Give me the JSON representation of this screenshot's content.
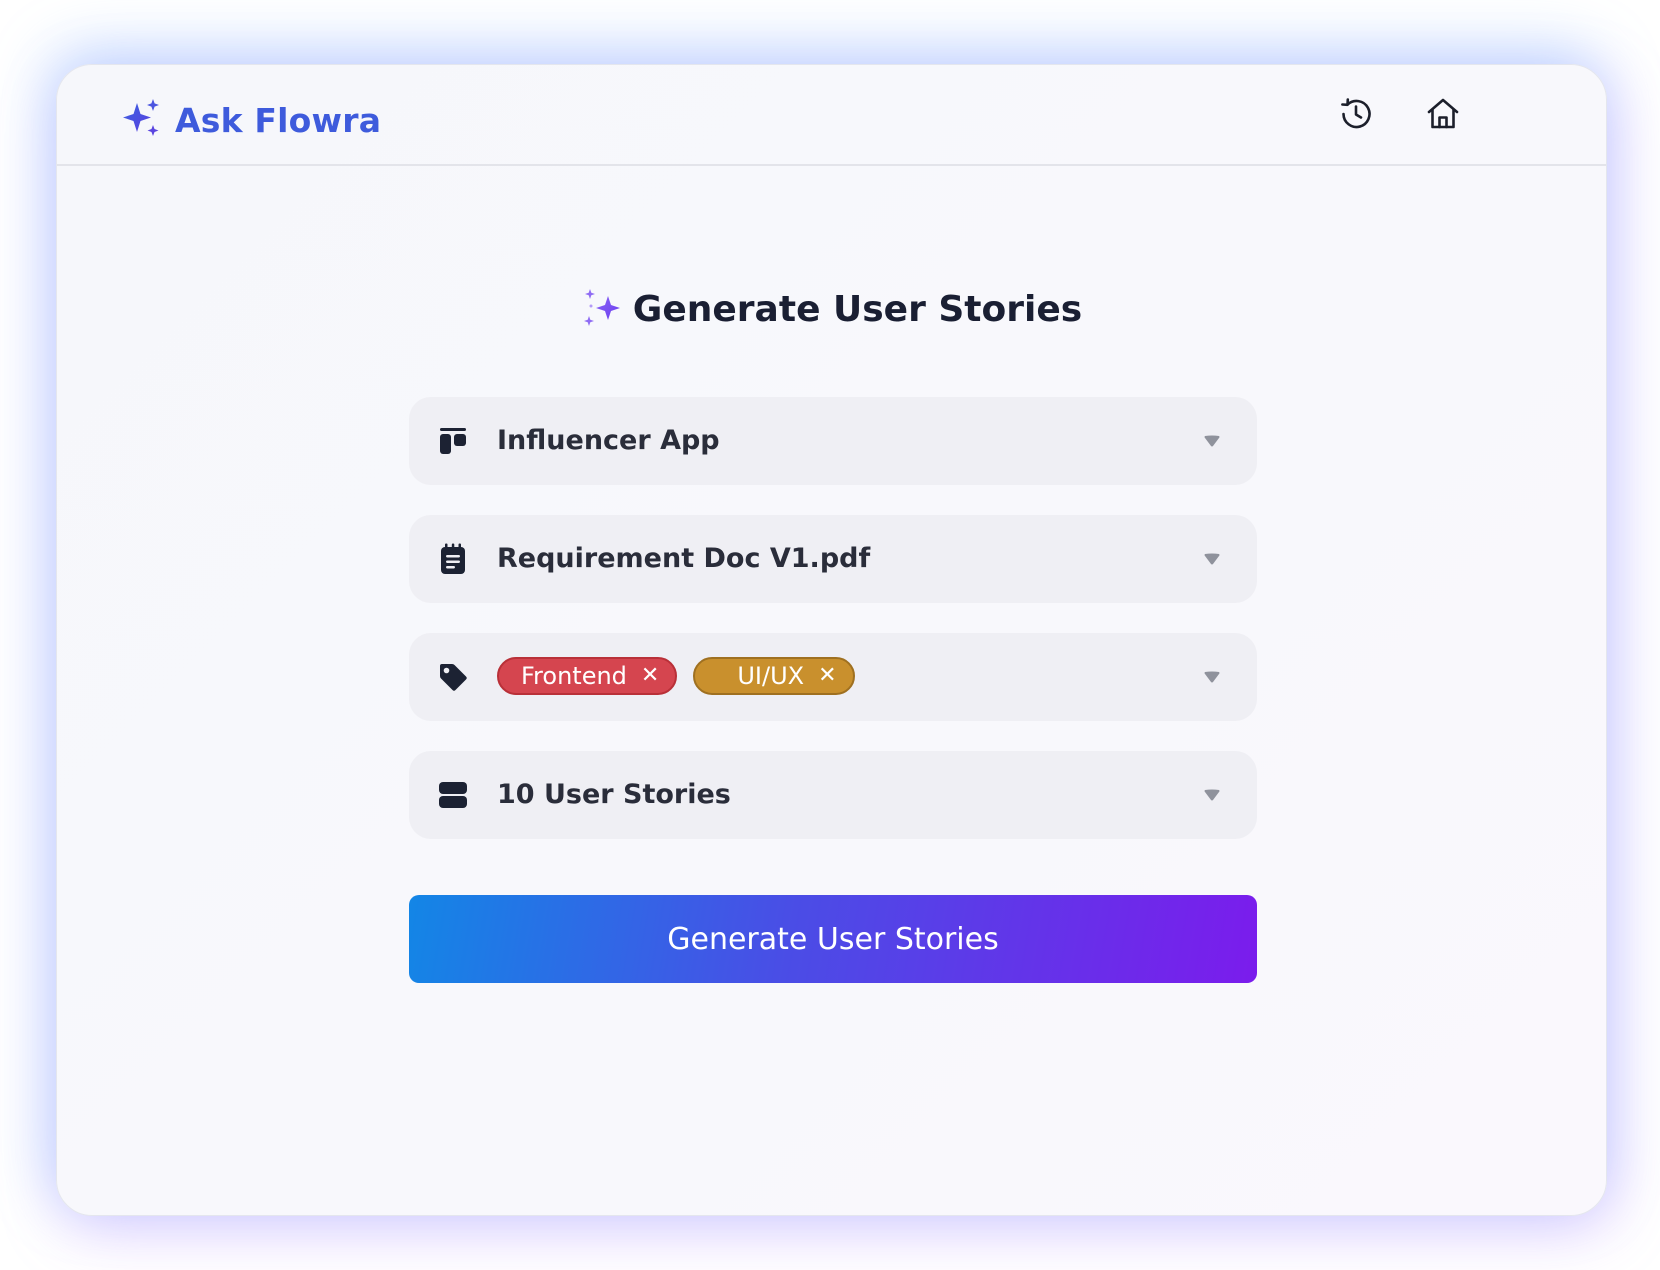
{
  "header": {
    "brand_name": "Ask Flowra",
    "brand_color": "#3e5bdc",
    "history_icon": "history-icon",
    "home_icon": "home-icon"
  },
  "main": {
    "title": "Generate User Stories",
    "fields": {
      "project": {
        "icon": "board-icon",
        "value": "Influencer App"
      },
      "document": {
        "icon": "notepad-icon",
        "value": "Requirement Doc V1.pdf"
      },
      "tags": {
        "icon": "tag-icon",
        "chips": [
          {
            "label": "Frontend",
            "color": "#d5454f"
          },
          {
            "label": "UI/UX",
            "color": "#c9902d"
          }
        ]
      },
      "count": {
        "icon": "stack-icon",
        "value": "10 User Stories"
      }
    },
    "generate_button_label": "Generate User Stories",
    "accent_gradient": [
      "#1386e6",
      "#7b1cec"
    ]
  }
}
